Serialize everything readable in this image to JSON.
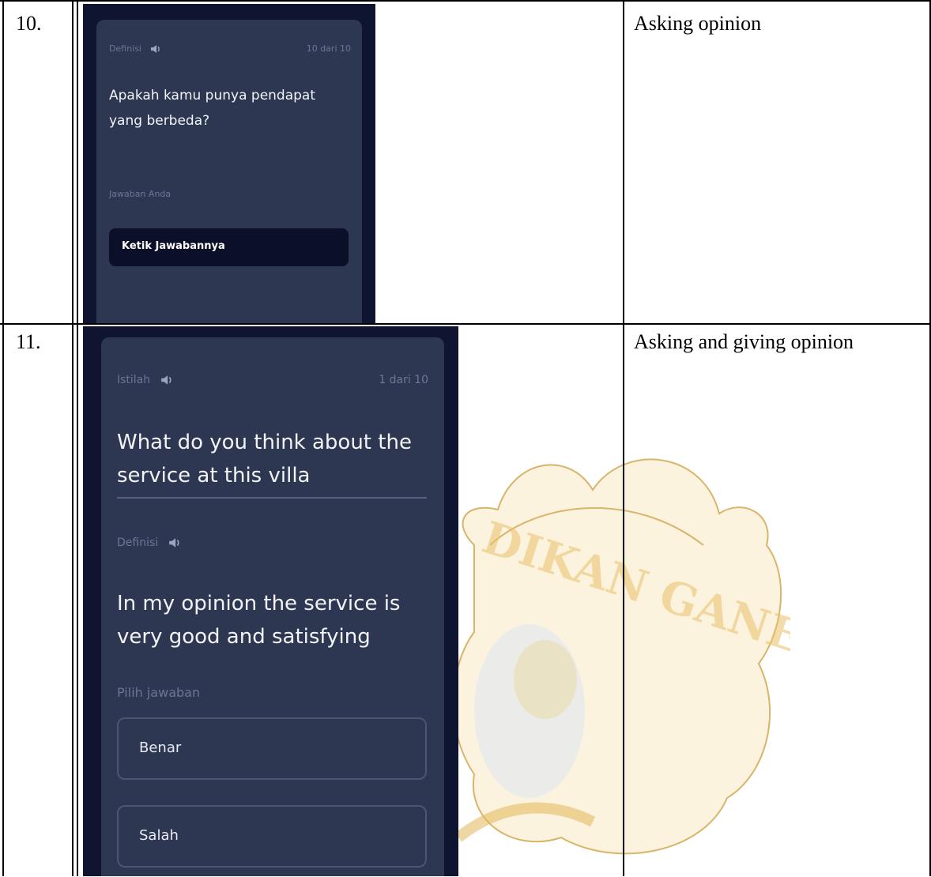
{
  "rows": [
    {
      "number": "10.",
      "description": "Asking opinion",
      "screen": {
        "label": "Definisi",
        "counter": "10 dari 10",
        "question": "Apakah kamu punya pendapat yang berbeda?",
        "answer_label": "Jawaban Anda",
        "input_placeholder": "Ketik Jawabannya"
      }
    },
    {
      "number": "11.",
      "description": "Asking and giving opinion",
      "screen": {
        "term_label": "Istilah",
        "counter": "1 dari 10",
        "term": "What do you think about the service at this villa",
        "definition_label": "Definisi",
        "definition": "In my opinion the service is very good and satisfying",
        "choose_label": "Pilih jawaban",
        "options": [
          "Benar",
          "Salah"
        ]
      }
    }
  ],
  "watermark": {
    "text": "DIKAN GANESHA",
    "color": "#e9c16a"
  },
  "colors": {
    "screen_bg": "#0f1530",
    "card_bg": "#2d3752",
    "muted_text": "#6a7694",
    "watermark": "#e9c16a"
  }
}
